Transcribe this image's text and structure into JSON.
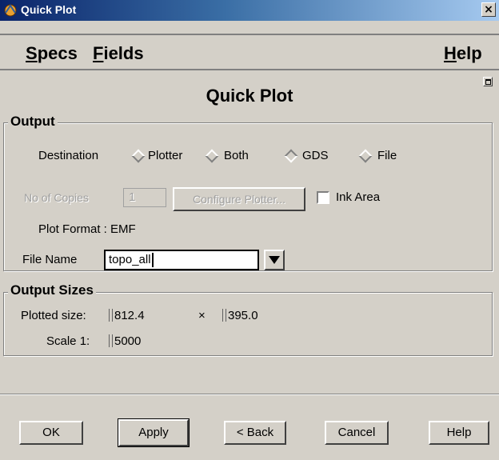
{
  "window": {
    "title": "Quick Plot",
    "close_label": "×"
  },
  "menubar": {
    "specs": {
      "mnemonic": "S",
      "rest": "pecs"
    },
    "fields": {
      "mnemonic": "F",
      "rest": "ields"
    },
    "help": {
      "mnemonic": "H",
      "rest": "elp"
    }
  },
  "main_title": "Quick Plot",
  "output": {
    "group_label": "Output",
    "destination_label": "Destination",
    "options": [
      "Plotter",
      "Both",
      "GDS",
      "File"
    ],
    "selected": "GDS",
    "copies_label": "No of Copies",
    "copies_value": "1",
    "configure_label": "Configure Plotter...",
    "ink_area_label": "Ink Area",
    "ink_area_checked": false,
    "plot_format_label": "Plot Format : EMF",
    "file_name_label": "File Name",
    "file_name_value": "topo_all"
  },
  "output_sizes": {
    "group_label": "Output Sizes",
    "plotted_label": "Plotted size:",
    "width": "812.4",
    "times": "×",
    "height": "395.0",
    "scale_label": "Scale 1:",
    "scale": "5000"
  },
  "buttons": {
    "ok": "OK",
    "apply": "Apply",
    "back": "< Back",
    "cancel": "Cancel",
    "help": "Help"
  }
}
